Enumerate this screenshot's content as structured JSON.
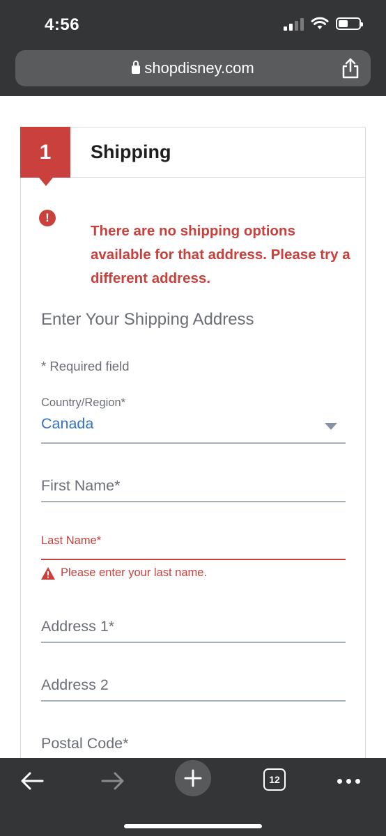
{
  "status_bar": {
    "time": "4:56"
  },
  "browser": {
    "url": "shopdisney.com",
    "tab_count": "12"
  },
  "checkout": {
    "step_number": "1",
    "step_title": "Shipping",
    "error_message": "There are no shipping options available for that address. Please try a different address.",
    "section_title": "Enter Your Shipping Address",
    "required_note": "* Required field",
    "fields": {
      "country": {
        "label": "Country/Region*",
        "value": "Canada"
      },
      "first_name": {
        "placeholder": "First Name*"
      },
      "last_name": {
        "label": "Last Name*",
        "error": "Please enter your last name."
      },
      "address1": {
        "placeholder": "Address 1*"
      },
      "address2": {
        "placeholder": "Address 2"
      },
      "postal_code": {
        "placeholder": "Postal Code*"
      }
    }
  },
  "colors": {
    "error_red": "#c9403c",
    "link_blue": "#3273c8",
    "chrome_dark": "#343536"
  }
}
